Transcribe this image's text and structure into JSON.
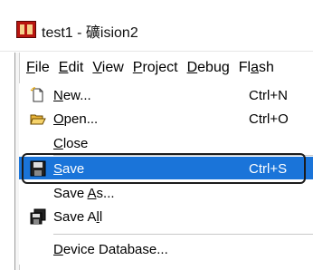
{
  "title": {
    "app_name": "test1",
    "separator": " - ",
    "product": "礦ision2"
  },
  "menubar": {
    "items": [
      {
        "label": "File",
        "underline": "F",
        "rest": "ile"
      },
      {
        "label": "Edit",
        "underline": "E",
        "rest": "dit"
      },
      {
        "label": "View",
        "underline": "V",
        "rest": "iew"
      },
      {
        "label": "Project",
        "underline": "P",
        "rest": "roject"
      },
      {
        "label": "Debug",
        "underline": "D",
        "rest": "ebug"
      },
      {
        "label": "Flash",
        "pre": "Fl",
        "underline": "a",
        "rest": "sh"
      }
    ]
  },
  "file_menu": {
    "new": {
      "label_u": "N",
      "label_rest": "ew...",
      "shortcut": "Ctrl+N"
    },
    "open": {
      "label_u": "O",
      "label_rest": "pen...",
      "shortcut": "Ctrl+O"
    },
    "close": {
      "label_u": "C",
      "label_rest": "lose"
    },
    "save": {
      "label_u": "S",
      "label_rest": "ave",
      "shortcut": "Ctrl+S"
    },
    "save_as": {
      "label_pre": "Save ",
      "label_u": "A",
      "label_rest": "s..."
    },
    "save_all": {
      "label_pre": "Save A",
      "label_u": "l",
      "label_rest": "l"
    },
    "device_db": {
      "label_u": "D",
      "label_rest": "evice Database..."
    }
  },
  "colors": {
    "selection": "#1a74d9",
    "app_icon": "#b8150f"
  },
  "icons": {
    "app": "keil-uvision-icon",
    "new": "new-file-icon",
    "open": "open-folder-icon",
    "save": "floppy-disk-icon",
    "save_all": "save-all-icon"
  }
}
